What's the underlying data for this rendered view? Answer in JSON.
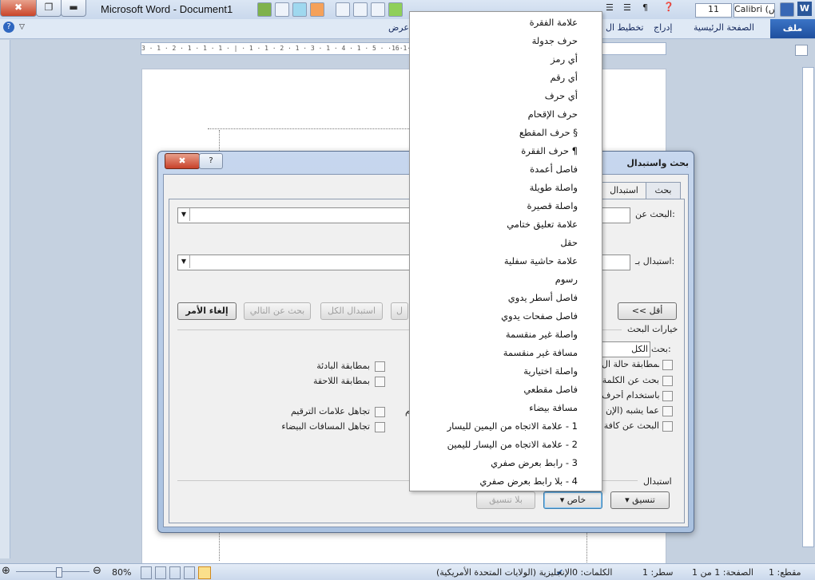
{
  "window": {
    "title": "Microsoft Word - Document1",
    "close_glyph": "✖",
    "restore_glyph": "❐",
    "minimize_glyph": "▬"
  },
  "quick_access": {
    "font_size": "11",
    "font_name": "Calibri (أسس"
  },
  "ribbon_tabs": {
    "file": "ملف",
    "home": "الصفحة الرئيسية",
    "insert": "إدراج",
    "layout": "تخطيط ال",
    "view": "عرض"
  },
  "ruler": {
    "ticks": "3 · 1 · 2 · 1 · 1 · 1 · | · 1 · 1 · 2 · 1 · 3 · 1 · 4 · 1 · 5 ·                   ·16·1·17·1·18·"
  },
  "dialog": {
    "title": "بحث واستبدال",
    "close_glyph": "✖",
    "help_glyph": "?",
    "tab_find": "بحث",
    "tab_replace": "استبدال",
    "find_label": "البحث عن:",
    "replace_label": "استبدال بـ:",
    "less_button": "<< أقل",
    "cancel_button": "إلغاء الأمر",
    "find_next_button": "بحث عن التالي",
    "replace_all_button": "استبدال الكل",
    "replace_partial_button": "ل",
    "search_options_title": "خيارات البحث",
    "search_label": "بحث:",
    "search_scope": "الكل",
    "options_right": [
      "بمطابقة حالة ال",
      "بحث عن الكلمة",
      "باستخدام أحرف",
      "عما يشبه (الإن",
      "البحث عن كافة"
    ],
    "options_left": [
      "بمطابقة البادئة",
      "بمطابقة اللاحقة",
      "تجاهل علامات الترقيم",
      "تجاهل المسافات البيضاء"
    ],
    "partial_m": "م",
    "replace_section": "استبدال",
    "format_button": "تنسيق",
    "special_button": "خاص",
    "no_format_button": "بلا تنسيق"
  },
  "special_menu": {
    "items": [
      "علامة الفقرة",
      "حرف جدولة",
      "أي رمز",
      "أي رقم",
      "أي حرف",
      "حرف الإقحام",
      "§ حرف المقطع",
      "¶ حرف الفقرة",
      "فاصل أعمدة",
      "واصلة طويلة",
      "واصلة قصيرة",
      "علامة تعليق ختامي",
      "حقل",
      "علامة حاشية سفلية",
      "رسوم",
      "فاصل أسطر يدوي",
      "فاصل صفحات يدوي",
      "واصلة غير منقسمة",
      "مسافة غير منقسمة",
      "واصلة اختيارية",
      "فاصل مقطعي",
      "مسافة بيضاء",
      "1 - علامة الاتجاه من اليمين لليسار",
      "2 - علامة الاتجاه من اليسار لليمين",
      "3 - رابط بعرض صفري",
      "4 - بلا رابط بعرض صفري"
    ]
  },
  "status": {
    "section": "مقطع: 1",
    "page": "الصفحة: 1 من 1",
    "line": "سطر: 1",
    "words": "الكلمات: 0",
    "language": "الإنجليزية (الولايات المتحدة الأمريكية)",
    "zoom": "80%"
  }
}
